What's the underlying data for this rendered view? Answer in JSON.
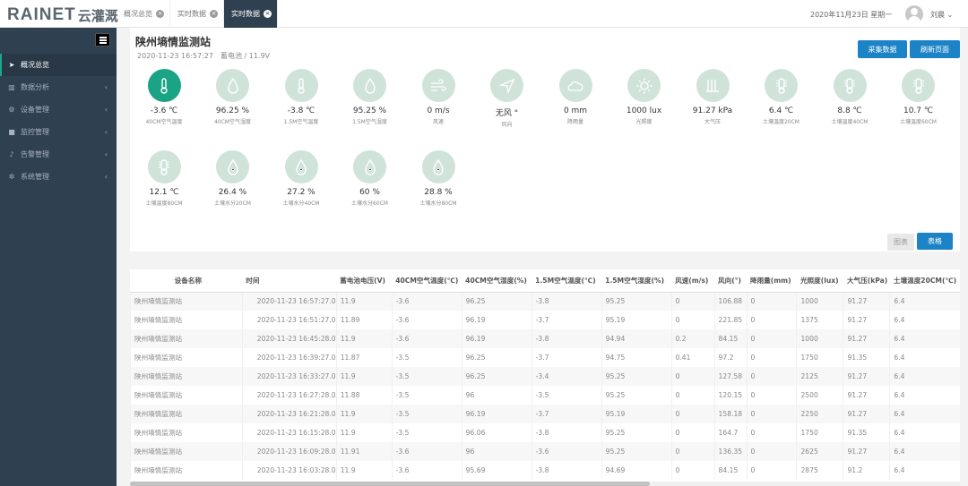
{
  "brand": {
    "text": "RAINET",
    "cn": "云灌溉"
  },
  "tabs": [
    {
      "label": "概况总览",
      "active": false
    },
    {
      "label": "实时数据",
      "active": false
    },
    {
      "label": "实时数据",
      "active": true
    }
  ],
  "date": "2020年11月23日 星期一",
  "user": "刘晨",
  "sidebar": {
    "items": [
      {
        "label": "概况总览",
        "icon": "send-icon",
        "active": true
      },
      {
        "label": "数据分析",
        "icon": "bar-chart-icon"
      },
      {
        "label": "设备管理",
        "icon": "gear-icon"
      },
      {
        "label": "监控管理",
        "icon": "video-camera-icon"
      },
      {
        "label": "告警管理",
        "icon": "bell-icon"
      },
      {
        "label": "系统管理",
        "icon": "gears-icon"
      }
    ]
  },
  "station": {
    "title": "陕州墒情监测站",
    "time": "2020-11-23 16:57:27",
    "battery": "蓄电池 / 11.9V"
  },
  "buttons": {
    "collect": "采集数据",
    "refresh": "刷新页面"
  },
  "metrics": [
    {
      "value": "-3.6 ℃",
      "name": "40CM空气温度",
      "icon": "thermometer-icon",
      "dark": true
    },
    {
      "value": "96.25 %",
      "name": "40CM空气湿度",
      "icon": "drop-icon"
    },
    {
      "value": "-3.8 ℃",
      "name": "1.5M空气温度",
      "icon": "thermometer-icon"
    },
    {
      "value": "95.25 %",
      "name": "1.5M空气湿度",
      "icon": "drop-icon"
    },
    {
      "value": "0 m/s",
      "name": "风速",
      "icon": "wind-icon"
    },
    {
      "value": "无风 °",
      "name": "风向",
      "icon": "navigation-icon"
    },
    {
      "value": "0 mm",
      "name": "降雨量",
      "icon": "cloud-icon"
    },
    {
      "value": "1000 lux",
      "name": "光照度",
      "icon": "sun-icon"
    },
    {
      "value": "91.27 kPa",
      "name": "大气压",
      "icon": "pressure-icon"
    },
    {
      "value": "6.4 ℃",
      "name": "土壤温度20CM",
      "icon": "soil-temp-icon"
    },
    {
      "value": "8.8 ℃",
      "name": "土壤温度40CM",
      "icon": "soil-temp-icon"
    },
    {
      "value": "10.7 ℃",
      "name": "土壤温度60CM",
      "icon": "soil-temp-icon"
    },
    {
      "value": "12.1 ℃",
      "name": "土壤温度80CM",
      "icon": "soil-temp-icon"
    },
    {
      "value": "26.4 %",
      "name": "土壤水分20CM",
      "icon": "soil-moisture-icon"
    },
    {
      "value": "27.2 %",
      "name": "土壤水分40CM",
      "icon": "soil-moisture-icon"
    },
    {
      "value": "60 %",
      "name": "土壤水分60CM",
      "icon": "soil-moisture-icon"
    },
    {
      "value": "28.8 %",
      "name": "土壤水分80CM",
      "icon": "soil-moisture-icon"
    }
  ],
  "view": {
    "chart": "图表",
    "table": "表格"
  },
  "table": {
    "headers": [
      "设备名称",
      "时间",
      "蓄电池电压(V)",
      "40CM空气温度(℃)",
      "40CM空气湿度(%)",
      "1.5M空气温度(℃)",
      "1.5M空气湿度(%)",
      "风速(m/s)",
      "风向(°)",
      "降雨量(mm)",
      "光照度(lux)",
      "大气压(kPa)",
      "土壤温度20CM(℃)"
    ],
    "rows": [
      [
        "陕州墒情监测站",
        "2020-11-23 16:57:27.0",
        "11.9",
        "-3.6",
        "96.25",
        "-3.8",
        "95.25",
        "0",
        "106.88",
        "0",
        "1000",
        "91.27",
        "6.4"
      ],
      [
        "陕州墒情监测站",
        "2020-11-23 16:51:27.0",
        "11.89",
        "-3.6",
        "96.19",
        "-3.7",
        "95.19",
        "0",
        "221.85",
        "0",
        "1375",
        "91.27",
        "6.4"
      ],
      [
        "陕州墒情监测站",
        "2020-11-23 16:45:28.0",
        "11.9",
        "-3.6",
        "96.19",
        "-3.8",
        "94.94",
        "0.2",
        "84.15",
        "0",
        "1000",
        "91.27",
        "6.4"
      ],
      [
        "陕州墒情监测站",
        "2020-11-23 16:39:27.0",
        "11.87",
        "-3.5",
        "96.25",
        "-3.7",
        "94.75",
        "0.41",
        "97.2",
        "0",
        "1750",
        "91.35",
        "6.4"
      ],
      [
        "陕州墒情监测站",
        "2020-11-23 16:33:27.0",
        "11.9",
        "-3.5",
        "96.25",
        "-3.4",
        "95.25",
        "0",
        "127.58",
        "0",
        "2125",
        "91.27",
        "6.4"
      ],
      [
        "陕州墒情监测站",
        "2020-11-23 16:27:28.0",
        "11.88",
        "-3.5",
        "96",
        "-3.5",
        "95.25",
        "0",
        "120.15",
        "0",
        "2500",
        "91.27",
        "6.4"
      ],
      [
        "陕州墒情监测站",
        "2020-11-23 16:21:28.0",
        "11.9",
        "-3.5",
        "96.19",
        "-3.7",
        "95.19",
        "0",
        "158.18",
        "0",
        "2250",
        "91.27",
        "6.4"
      ],
      [
        "陕州墒情监测站",
        "2020-11-23 16:15:28.0",
        "11.9",
        "-3.5",
        "96.06",
        "-3.8",
        "95.25",
        "0",
        "164.7",
        "0",
        "1750",
        "91.35",
        "6.4"
      ],
      [
        "陕州墒情监测站",
        "2020-11-23 16:09:28.0",
        "11.91",
        "-3.6",
        "96",
        "-3.6",
        "95.25",
        "0",
        "136.35",
        "0",
        "2625",
        "91.27",
        "6.4"
      ],
      [
        "陕州墒情监测站",
        "2020-11-23 16:03:28.0",
        "11.9",
        "-3.6",
        "95.69",
        "-3.8",
        "94.69",
        "0",
        "84.15",
        "0",
        "2875",
        "91.2",
        "6.4"
      ]
    ]
  }
}
